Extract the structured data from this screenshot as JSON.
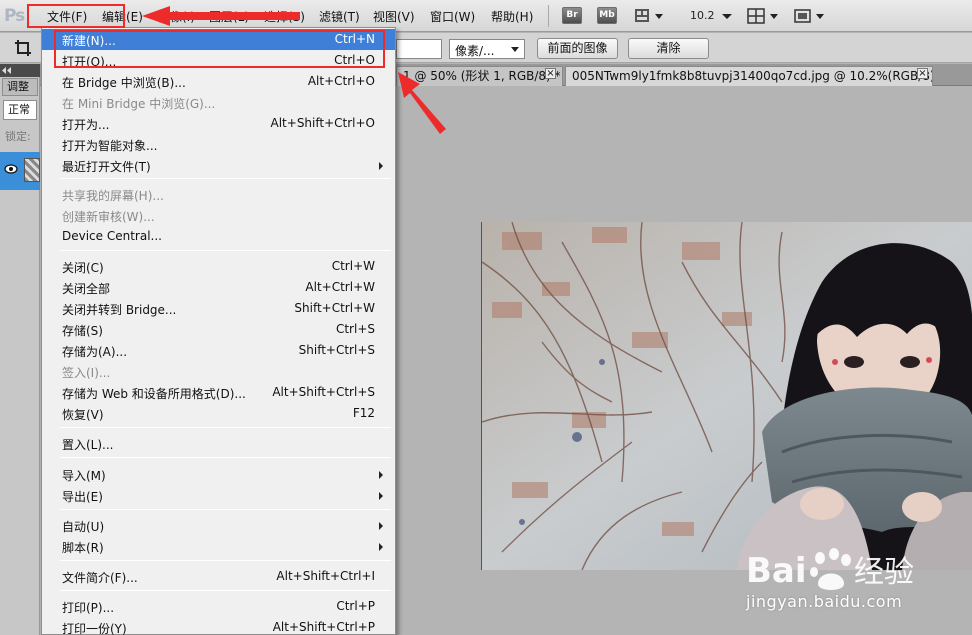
{
  "app": {
    "logo": "Ps"
  },
  "menubar": {
    "items": [
      "文件(F)",
      "编辑(E)",
      "图像(I)",
      "图层(L)",
      "选择(S)",
      "滤镜(T)",
      "视图(V)",
      "窗口(W)",
      "帮助(H)"
    ],
    "bridge_badge": "Br",
    "minibridge_badge": "Mb",
    "zoom_value": "10.2"
  },
  "options_bar": {
    "units_select": "像素/...",
    "front_image_button": "前面的图像",
    "clear_button": "清除"
  },
  "left_panel": {
    "tab_label": "调整",
    "blend_mode": "正常",
    "lock_label": "锁定:"
  },
  "doc_tabs": [
    {
      "title": "1 @ 50% (形状 1, RGB/8) *",
      "close": "×"
    },
    {
      "title": "005NTwm9ly1fmk8b8tuvpj31400qo7cd.jpg @ 10.2%(RGB/8) *",
      "close": "×"
    }
  ],
  "file_menu": {
    "items": [
      {
        "label": "新建(N)...",
        "shortcut": "Ctrl+N",
        "highlighted": true
      },
      {
        "label": "打开(O)...",
        "shortcut": "Ctrl+O"
      },
      {
        "label": "在 Bridge 中浏览(B)...",
        "shortcut": "Alt+Ctrl+O"
      },
      {
        "label": "在 Mini Bridge 中浏览(G)...",
        "shortcut": "",
        "disabled": true
      },
      {
        "label": "打开为...",
        "shortcut": "Alt+Shift+Ctrl+O"
      },
      {
        "label": "打开为智能对象...",
        "shortcut": ""
      },
      {
        "label": "最近打开文件(T)",
        "shortcut": "",
        "submenu": true
      },
      {
        "label": "共享我的屏幕(H)...",
        "shortcut": "",
        "disabled": true
      },
      {
        "label": "创建新审核(W)...",
        "shortcut": "",
        "disabled": true
      },
      {
        "label": "Device Central...",
        "shortcut": ""
      },
      {
        "label": "关闭(C)",
        "shortcut": "Ctrl+W"
      },
      {
        "label": "关闭全部",
        "shortcut": "Alt+Ctrl+W"
      },
      {
        "label": "关闭并转到 Bridge...",
        "shortcut": "Shift+Ctrl+W"
      },
      {
        "label": "存储(S)",
        "shortcut": "Ctrl+S"
      },
      {
        "label": "存储为(A)...",
        "shortcut": "Shift+Ctrl+S"
      },
      {
        "label": "签入(I)...",
        "shortcut": "",
        "disabled": true
      },
      {
        "label": "存储为 Web 和设备所用格式(D)...",
        "shortcut": "Alt+Shift+Ctrl+S"
      },
      {
        "label": "恢复(V)",
        "shortcut": "F12"
      },
      {
        "label": "置入(L)...",
        "shortcut": ""
      },
      {
        "label": "导入(M)",
        "shortcut": "",
        "submenu": true
      },
      {
        "label": "导出(E)",
        "shortcut": "",
        "submenu": true
      },
      {
        "label": "自动(U)",
        "shortcut": "",
        "submenu": true
      },
      {
        "label": "脚本(R)",
        "shortcut": "",
        "submenu": true
      },
      {
        "label": "文件简介(F)...",
        "shortcut": "Alt+Shift+Ctrl+I"
      },
      {
        "label": "打印(P)...",
        "shortcut": "Ctrl+P"
      },
      {
        "label": "打印一份(Y)",
        "shortcut": "Alt+Shift+Ctrl+P"
      }
    ]
  },
  "watermark": {
    "brand_a": "Bai",
    "brand_b": "经验",
    "url": "jingyan.baidu.com"
  },
  "colors": {
    "annotation_red": "#ee2b2b",
    "menu_highlight": "#3f7fd8",
    "layer_selected": "#3b8ed8"
  }
}
